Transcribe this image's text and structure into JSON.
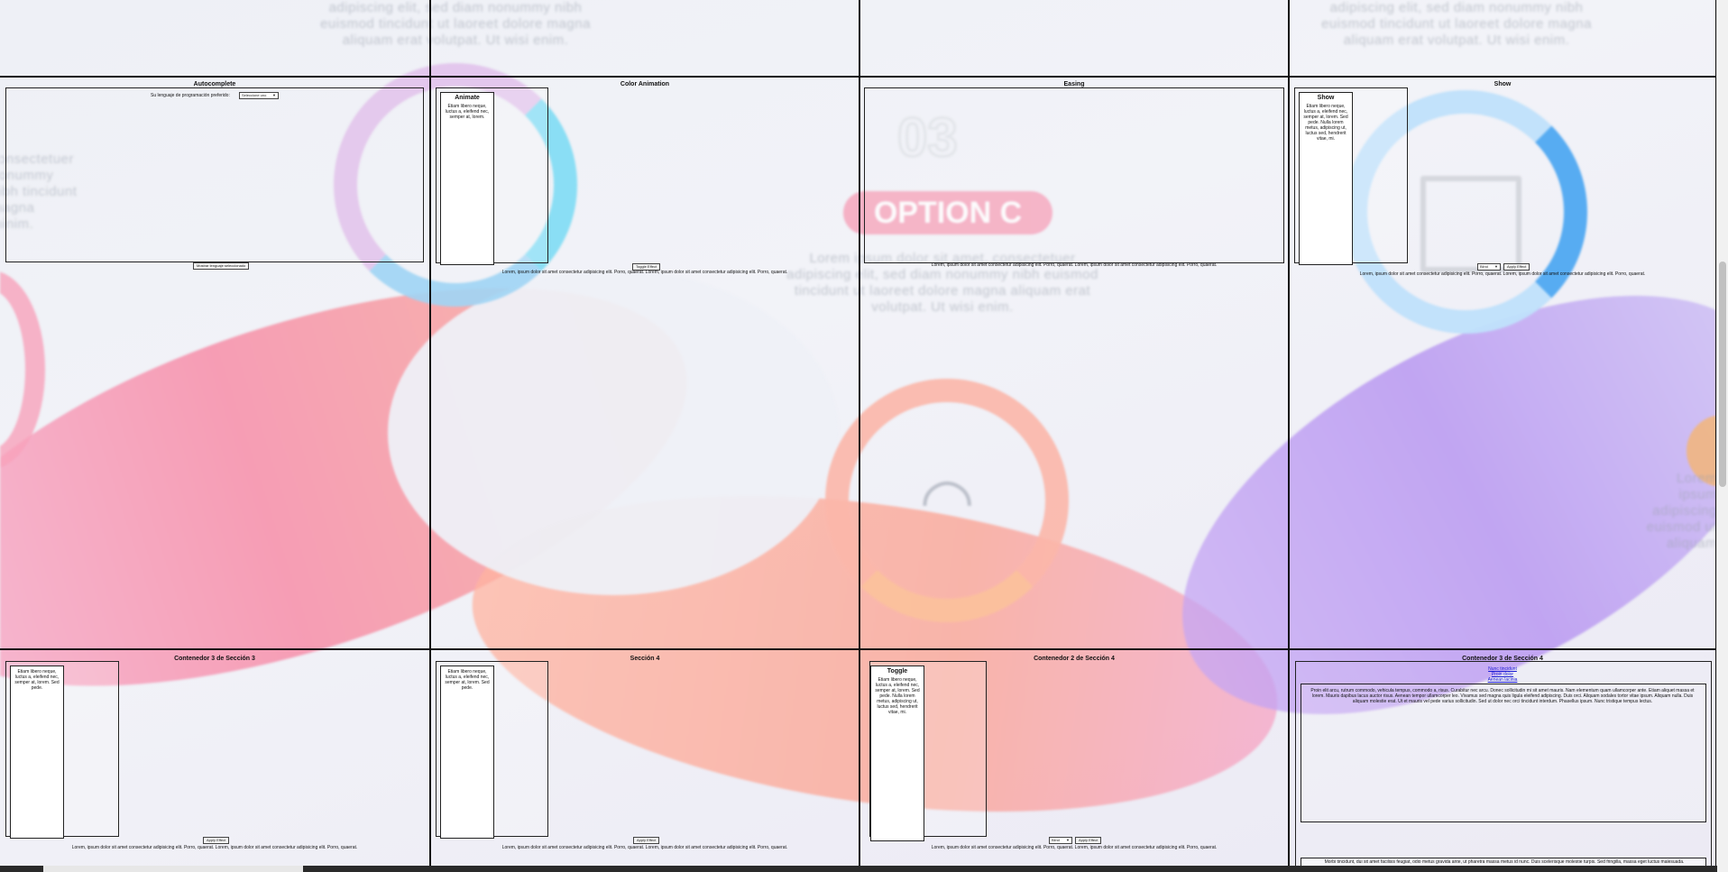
{
  "background": {
    "top_text_left": "adipiscing elit, sed diam nonummy nibh euismod tincidunt ut laoreet dolore magna aliquam erat volutpat. Ut wisi enim.",
    "top_text_right": "adipiscing elit, sed diam nonummy nibh euismod tincidunt ut laoreet dolore magna aliquam erat volutpat. Ut wisi enim.",
    "left_text": "consectetuer nonummy nibh tincidunt magna minim.",
    "center_text": "Lorem ipsum dolor sit amet, consectetuer adipiscing elit, sed diam nonummy nibh euismod tincidunt ut laoreet dolore magna aliquam erat volutpat. Ut wisi enim.",
    "right_text": "Lorem ipsum adipiscing euismod ut aliquam",
    "big_number": "03",
    "option_label": "OPTION C"
  },
  "panels": {
    "autocomplete": {
      "title": "Autocomplete",
      "label": "Su lenguaje de programación preferido:",
      "select_value": "Seleccione uno",
      "button": "Mostrar lenguaje seleccionado"
    },
    "color_animation": {
      "title": "Color Animation",
      "card_title": "Animate",
      "card_text": "Etiam libero neque, luctus a, eleifend nec, semper at, lorem.",
      "button": "Toggle Effect",
      "caption": "Lorem, ipsum dolor sit amet consectetur adipisicing elit. Porro, quaerat. Lorem, ipsum dolor sit amet consectetur adipisicing elit. Porro, quaerat."
    },
    "easing": {
      "title": "Easing",
      "caption": "Lorem, ipsum dolor sit amet consectetur adipisicing elit. Porro, quaerat. Lorem, ipsum dolor sit amet consectetur adipisicing elit. Porro, quaerat."
    },
    "show": {
      "title": "Show",
      "card_title": "Show",
      "card_text": "Etiam libero neque, luctus a, eleifend nec, semper at, lorem. Sed pede. Nulla lorem metus, adipiscing ut, luctus sed, hendrerit vitae, mi.",
      "select_value": "Blind",
      "button": "Apply Effect",
      "caption": "Lorem, ipsum dolor sit amet consectetur adipisicing elit. Porro, quaerat. Lorem, ipsum dolor sit amet consectetur adipisicing elit. Porro, quaerat."
    },
    "section3_c3": {
      "title": "Contenedor 3 de Sección 3",
      "card_text": "Etiam libero neque, luctus a, eleifend nec, semper at, lorem. Sed pede.",
      "button": "Apply Effect",
      "caption": "Lorem, ipsum dolor sit amet consectetur adipisicing elit. Porro, quaerat. Lorem, ipsum dolor sit amet consectetur adipisicing elit. Porro, quaerat."
    },
    "section4": {
      "title": "Sección 4",
      "card_text": "Etiam libero neque, luctus a, eleifend nec, semper at, lorem. Sed pede.",
      "button": "Apply Effect",
      "caption": "Lorem, ipsum dolor sit amet consectetur adipisicing elit. Porro, quaerat. Lorem, ipsum dolor sit amet consectetur adipisicing elit. Porro, quaerat."
    },
    "section4_c2": {
      "title": "Contenedor 2 de Sección 4",
      "card_title": "Toggle",
      "card_text": "Etiam libero neque, luctus a, eleifend nec, semper at, lorem. Sed pede. Nulla lorem metus, adipiscing ut, luctus sed, hendrerit vitae, mi.",
      "select_value": "Blind",
      "button": "Apply Effect",
      "caption": "Lorem, ipsum dolor sit amet consectetur adipisicing elit. Porro, quaerat. Lorem, ipsum dolor sit amet consectetur adipisicing elit. Porro, quaerat."
    },
    "section4_c3": {
      "title": "Contenedor 3 de Sección 4",
      "links": [
        "Nunc tincidunt",
        "Proin dolor",
        "Aenean lacinia"
      ],
      "paragraph": "Proin elit arcu, rutrum commodo, vehicula tempus, commodo a, risus. Curabitur nec arcu. Donec sollicitudin mi sit amet mauris. Nam elementum quam ullamcorper ante. Etiam aliquet massa et lorem. Mauris dapibus lacus auctor risus. Aenean tempor ullamcorper leo. Vivamus sed magna quis ligula eleifend adipiscing. Duis orci. Aliquam sodales tortor vitae ipsum. Aliquam nulla. Duis aliquam molestie erat. Ut et mauris vel pede varius sollicitudin. Sed ut dolor nec orci tincidunt interdum. Phasellus ipsum. Nunc tristique tempus lectus.",
      "footer_text": "Morbi tincidunt, dui sit amet facilisis feugiat, odio metus gravida ante, ut pharetra massa metus id nunc. Duis scelerisque molestie turpis. Sed fringilla, massa eget luctus malesuada."
    }
  }
}
